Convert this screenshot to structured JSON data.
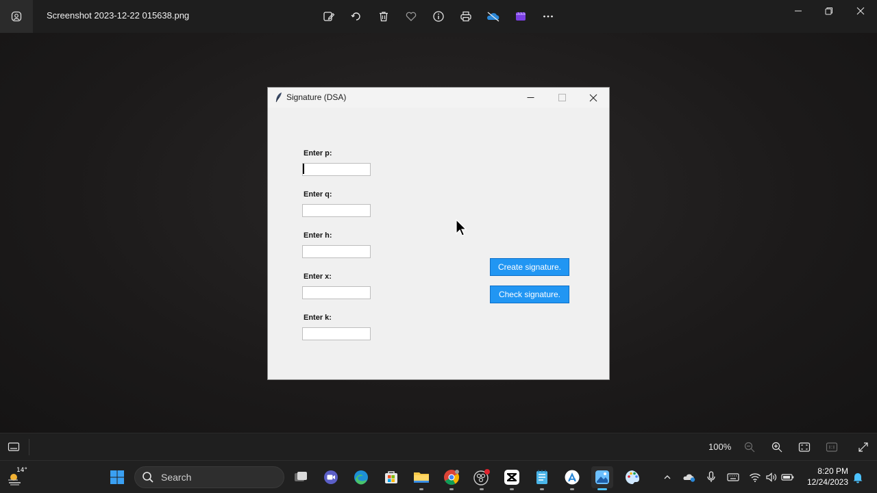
{
  "viewer": {
    "file_title": "Screenshot 2023-12-22 015638.png",
    "toolbar_icons": [
      "edit-icon",
      "rotate-icon",
      "delete-icon",
      "favorite-icon",
      "info-icon",
      "print-icon",
      "onedrive-icon",
      "clipchamp-icon",
      "more-icon"
    ],
    "zoom": "100%"
  },
  "dialog": {
    "title": "Signature (DSA)",
    "fields": [
      {
        "label": "Enter p:",
        "value": ""
      },
      {
        "label": "Enter q:",
        "value": ""
      },
      {
        "label": "Enter h:",
        "value": ""
      },
      {
        "label": "Enter x:",
        "value": ""
      },
      {
        "label": "Enter k:",
        "value": ""
      }
    ],
    "buttons": {
      "create": "Create signature.",
      "check": "Check signature."
    },
    "button_color": "#2196f3"
  },
  "taskbar": {
    "weather_temp": "14°",
    "search_placeholder": "Search",
    "clock_time": "8:20 PM",
    "clock_date": "12/24/2023",
    "accent": "#4cc2ff"
  }
}
